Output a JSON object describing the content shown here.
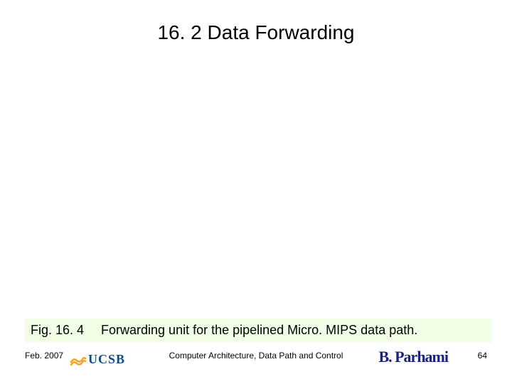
{
  "slide": {
    "title": "16. 2  Data Forwarding"
  },
  "figure": {
    "label": "Fig. 16. 4",
    "caption": "Forwarding unit for the pipelined Micro. MIPS data path."
  },
  "footer": {
    "date": "Feb. 2007",
    "logo_text": "UCSB",
    "subtitle": "Computer Architecture, Data Path and Control",
    "author": "B. Parhami",
    "page": "64"
  }
}
